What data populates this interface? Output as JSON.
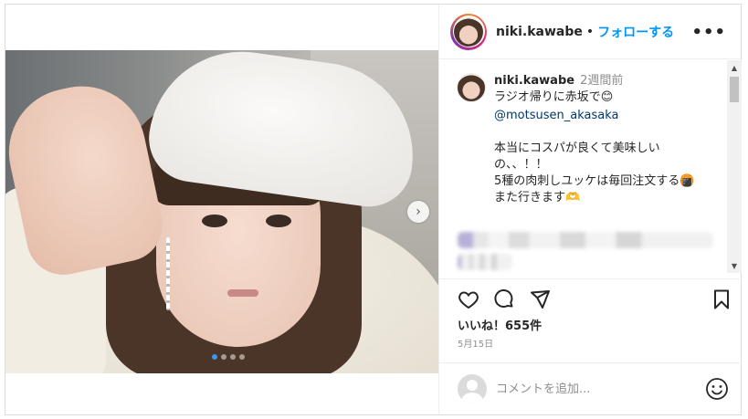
{
  "post": {
    "username": "niki.kawabe",
    "separator": "•",
    "follow_label": "フォローする",
    "more_label": "•••"
  },
  "caption": {
    "username": "niki.kawabe",
    "time": "2週間前",
    "line1": "ラジオ帰りに赤坂で😊",
    "mention": "@motsusen_akasaka",
    "line2": "本当にコスパが良くて美味しい",
    "line3": "の、、！！",
    "line4": "5種の肉刺しユッケは毎回注文する🍘",
    "line5": "また行きます🫶"
  },
  "scroll": {
    "up": "▲",
    "down": "▼"
  },
  "carousel": {
    "next_label": "›",
    "slide_count": 4,
    "active_index": 0
  },
  "engagement": {
    "likes": "いいね！655件",
    "date": "5月15日"
  },
  "comment_box": {
    "placeholder": "コメントを追加..."
  },
  "colors": {
    "link": "#0095f6",
    "mention": "#00376b",
    "muted": "#8e8e8e",
    "text": "#262626"
  },
  "icons": [
    "heart-icon",
    "comment-icon",
    "share-icon",
    "bookmark-icon",
    "emoji-icon",
    "more-icon",
    "next-arrow-icon"
  ]
}
